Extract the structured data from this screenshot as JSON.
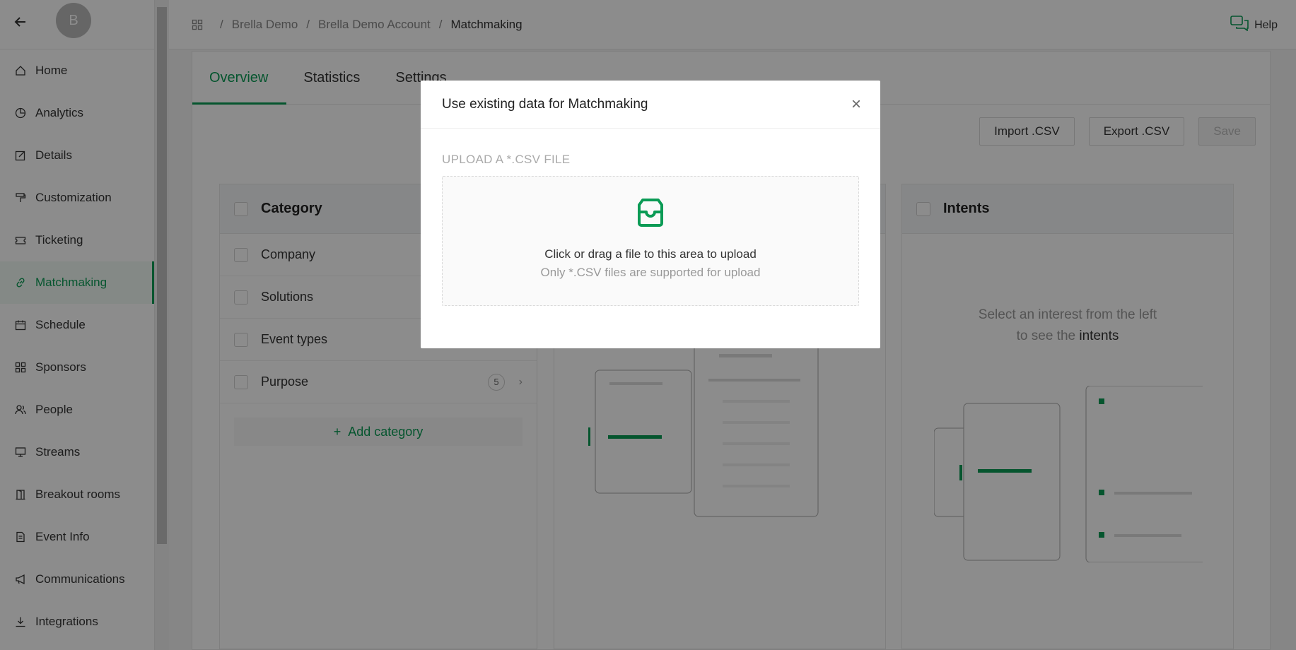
{
  "sidebar": {
    "avatar_letter": "B",
    "items": [
      {
        "label": "Home",
        "icon": "home-icon"
      },
      {
        "label": "Analytics",
        "icon": "pie-chart-icon"
      },
      {
        "label": "Details",
        "icon": "edit-icon"
      },
      {
        "label": "Customization",
        "icon": "paint-roller-icon"
      },
      {
        "label": "Ticketing",
        "icon": "ticket-icon"
      },
      {
        "label": "Matchmaking",
        "icon": "link-icon"
      },
      {
        "label": "Schedule",
        "icon": "calendar-icon"
      },
      {
        "label": "Sponsors",
        "icon": "grid-icon"
      },
      {
        "label": "People",
        "icon": "people-icon"
      },
      {
        "label": "Streams",
        "icon": "monitor-icon"
      },
      {
        "label": "Breakout rooms",
        "icon": "door-icon"
      },
      {
        "label": "Event Info",
        "icon": "document-icon"
      },
      {
        "label": "Communications",
        "icon": "megaphone-icon"
      },
      {
        "label": "Integrations",
        "icon": "download-icon"
      }
    ],
    "active": "Matchmaking"
  },
  "breadcrumb": [
    "Brella Demo",
    "Brella Demo Account",
    "Matchmaking"
  ],
  "help_label": "Help",
  "tabs": [
    "Overview",
    "Statistics",
    "Settings"
  ],
  "actions": {
    "import": "Import .CSV",
    "export": "Export .CSV",
    "save": "Save"
  },
  "category_panel": {
    "title": "Category",
    "rows": [
      "Company",
      "Solutions",
      "Event types",
      "Purpose"
    ],
    "purpose_count": "5",
    "add_label": "Add category"
  },
  "intents_panel": {
    "title": "Intents",
    "hint_line1": "Select an interest from the left",
    "hint_line2_prefix": "to see the",
    "hint_line2_emph": "intents"
  },
  "modal": {
    "title": "Use existing data for Matchmaking",
    "upload_title": "UPLOAD A *.CSV FILE",
    "dropzone_text": "Click or drag a file to this area to upload",
    "dropzone_hint": "Only *.CSV files are supported for upload"
  },
  "colors": {
    "accent": "#0a9b55",
    "overlay": "rgba(0,0,0,0.45)"
  }
}
